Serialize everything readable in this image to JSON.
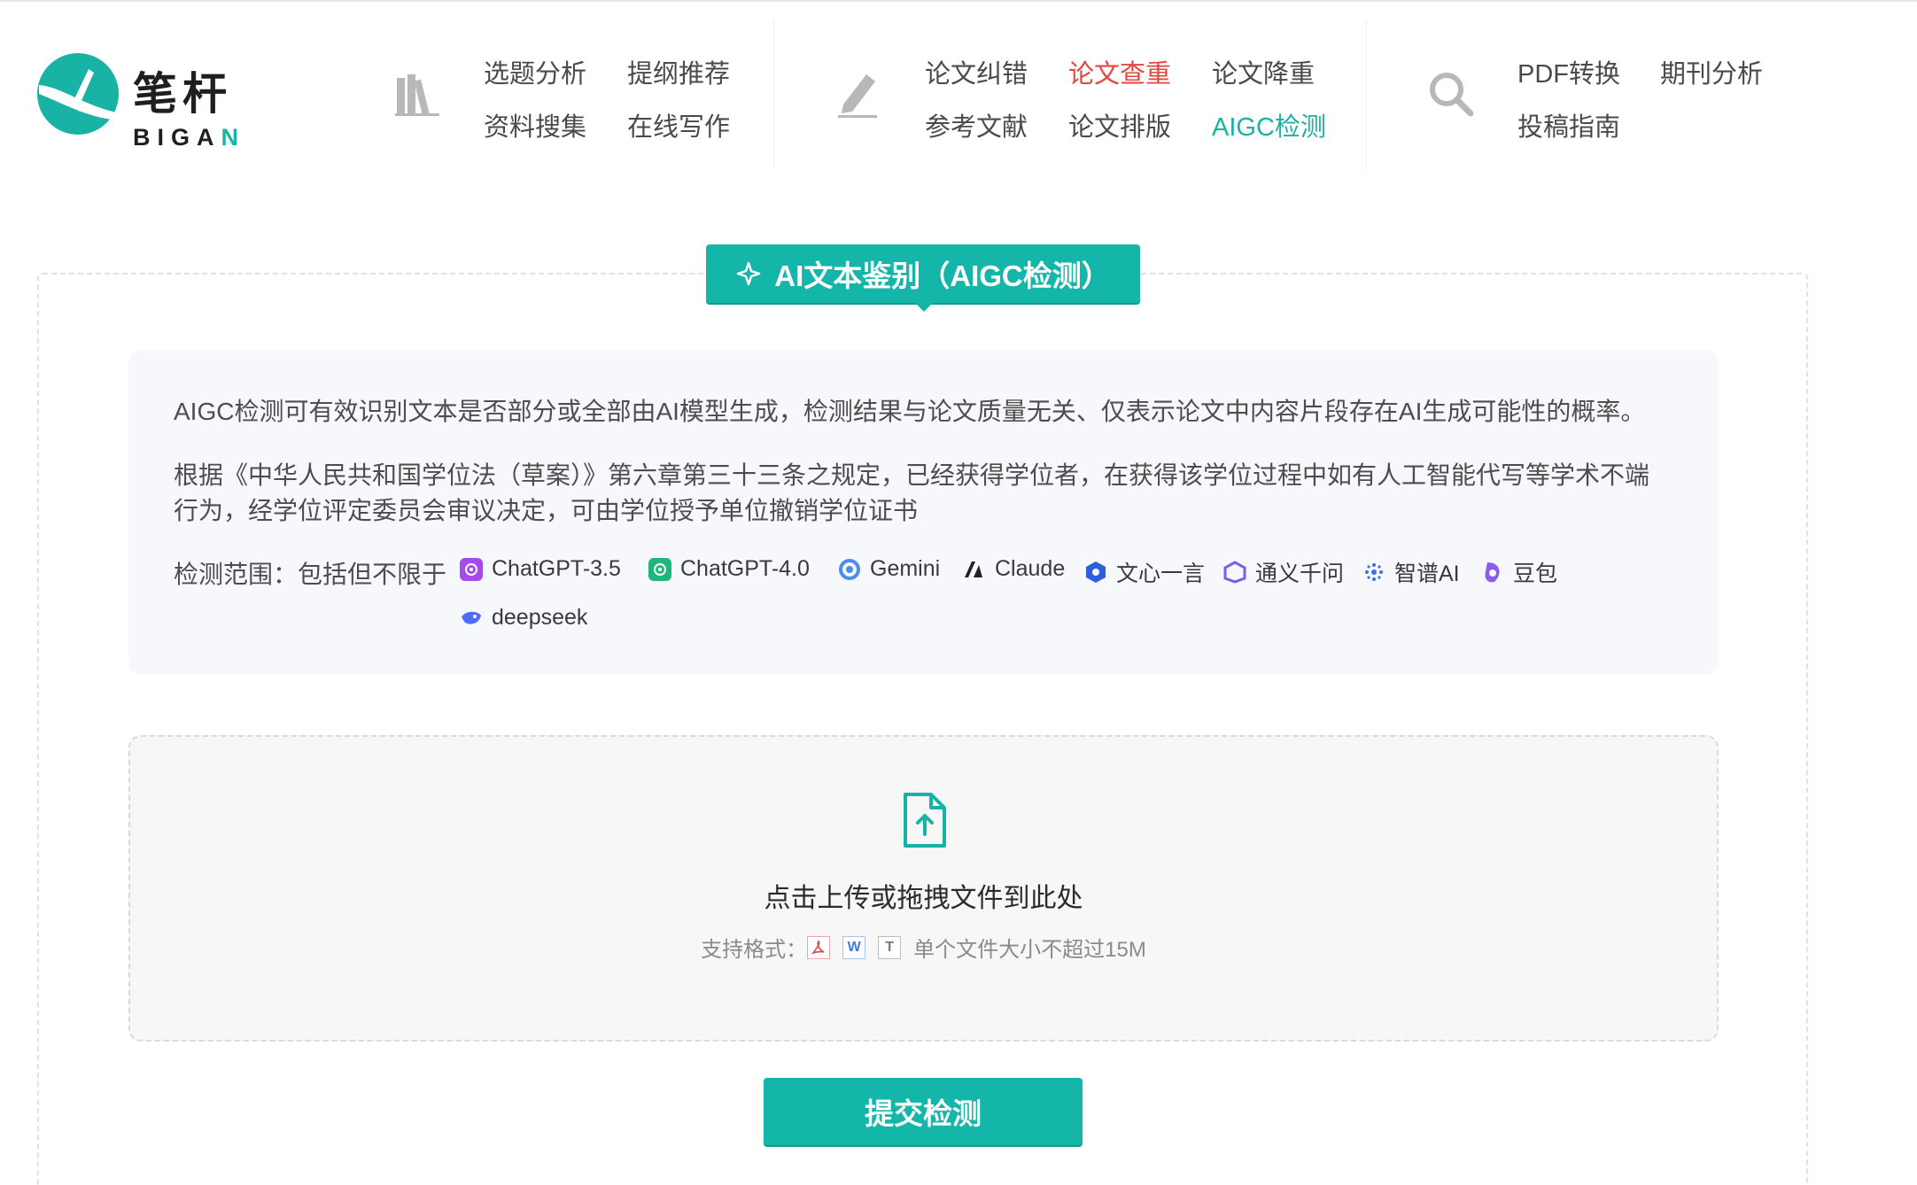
{
  "logo": {
    "cn": "笔杆",
    "en_prefix": "BIGA",
    "en_suffix": "N"
  },
  "nav": {
    "group1": {
      "icon": "books-icon",
      "links": [
        "选题分析",
        "提纲推荐",
        "资料搜集",
        "在线写作"
      ]
    },
    "group2": {
      "icon": "pen-icon",
      "links": [
        "论文纠错",
        "论文查重",
        "论文降重",
        "参考文献",
        "论文排版",
        "AIGC检测"
      ]
    },
    "group3": {
      "icon": "search-icon",
      "links": [
        "PDF转换",
        "期刊分析",
        "投稿指南"
      ]
    }
  },
  "colors": {
    "accent": "#14b6a9",
    "active_red": "#e0473f",
    "active_teal": "#19b3a5"
  },
  "badge": {
    "label": "AI文本鉴别（AIGC检测）",
    "icon": "sparkle-icon"
  },
  "info": {
    "para1": "AIGC检测可有效识别文本是否部分或全部由AI模型生成，检测结果与论文质量无关、仅表示论文中内容片段存在AI生成可能性的概率。",
    "para2_line1": "根据《中华人民共和国学位法（草案）》第六章第三十三条之规定，已经获得学位者，在获得该学位过程中如有人工智能代写等学术不端",
    "para2_line2": "行为，经学位评定委员会审议决定，可由学位授予单位撤销学位证书",
    "scope_label": "检测范围：包括但不限于",
    "models": [
      {
        "name": "ChatGPT-3.5",
        "icon": "chatgpt-icon"
      },
      {
        "name": "ChatGPT-4.0",
        "icon": "chatgpt-icon"
      },
      {
        "name": "Gemini",
        "icon": "gemini-icon"
      },
      {
        "name": "Claude",
        "icon": "claude-icon"
      },
      {
        "name": "文心一言",
        "icon": "wenxin-icon"
      },
      {
        "name": "通义千问",
        "icon": "tongyi-icon"
      },
      {
        "name": "智谱AI",
        "icon": "zhipu-icon"
      },
      {
        "name": "豆包",
        "icon": "doubao-icon"
      },
      {
        "name": "deepseek",
        "icon": "deepseek-icon"
      }
    ]
  },
  "upload": {
    "title": "点击上传或拖拽文件到此处",
    "formats_label": "支持格式：",
    "formats": [
      "pdf-icon",
      "word-icon",
      "txt-icon"
    ],
    "limit": "单个文件大小不超过15M"
  },
  "submit_label": "提交检测"
}
